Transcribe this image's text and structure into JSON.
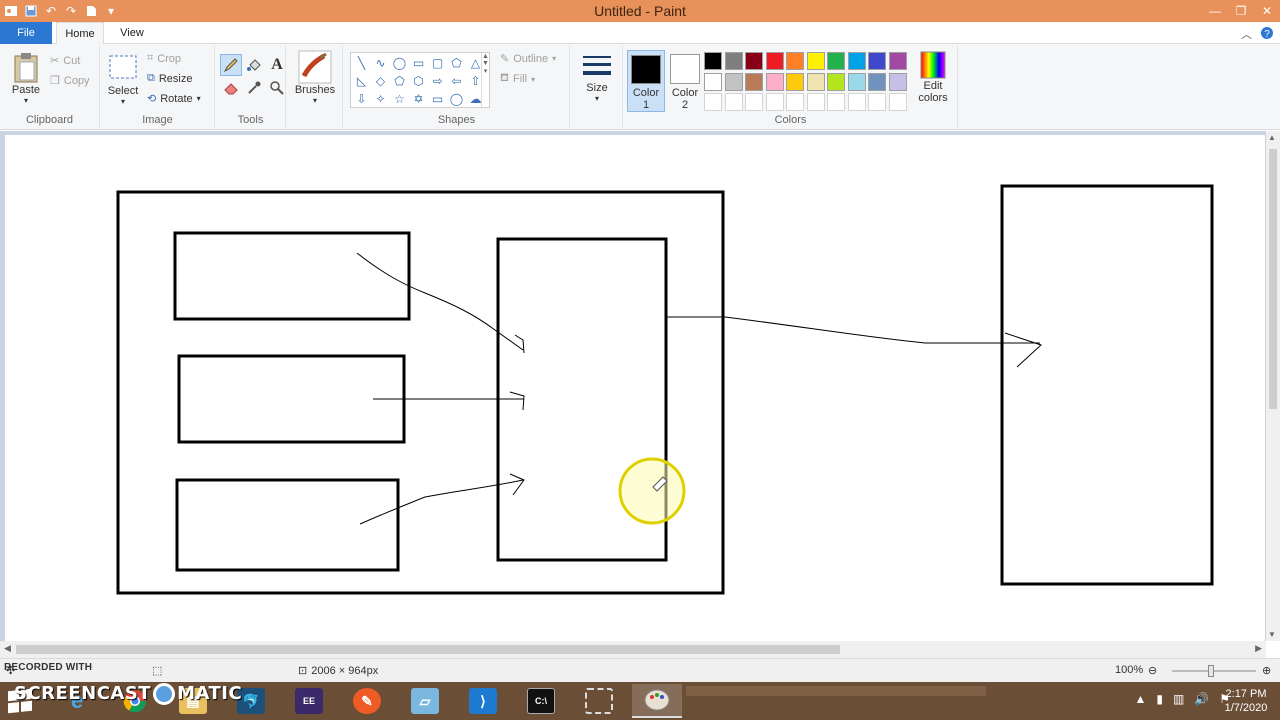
{
  "window": {
    "title": "Untitled - Paint",
    "controls": [
      "minimize",
      "restore",
      "close"
    ]
  },
  "tabs": [
    "File",
    "Home",
    "View"
  ],
  "ribbon": {
    "clipboard": {
      "paste": "Paste",
      "cut": "Cut",
      "copy": "Copy",
      "label": "Clipboard"
    },
    "image": {
      "select": "Select",
      "crop": "Crop",
      "resize": "Resize",
      "rotate": "Rotate",
      "label": "Image"
    },
    "tools": {
      "label": "Tools",
      "icons": [
        "pencil-icon",
        "fill-icon",
        "text-icon",
        "eraser-icon",
        "color-picker-icon",
        "magnifier-icon"
      ]
    },
    "brushes": {
      "label": "Brushes"
    },
    "shapes": {
      "outline": "Outline",
      "fill": "Fill",
      "label": "Shapes"
    },
    "size": {
      "label": "Size"
    },
    "colors": {
      "color1_label": "Color",
      "color1_num": "1",
      "color2_label": "Color",
      "color2_num": "2",
      "color1": "#000000",
      "color2": "#ffffff",
      "edit": "Edit colors",
      "label": "Colors",
      "palette_row1": [
        "#000000",
        "#7f7f7f",
        "#880015",
        "#ed1c24",
        "#ff7f27",
        "#fff200",
        "#22b14c",
        "#00a2e8",
        "#3f48cc",
        "#a349a4"
      ],
      "palette_row2": [
        "#ffffff",
        "#c3c3c3",
        "#b97a57",
        "#ffaec9",
        "#ffc90e",
        "#efe4b0",
        "#b5e61d",
        "#99d9ea",
        "#7092be",
        "#c8bfe7"
      ]
    }
  },
  "status": {
    "dimensions": "2006 × 964px",
    "zoom": "100%",
    "recorded": "RECORDED WITH"
  },
  "taskbar": {
    "screencast": "SCREENCAST",
    "screencast_end": "MATIC",
    "time": "2:17 PM",
    "date": "1/7/2020"
  }
}
